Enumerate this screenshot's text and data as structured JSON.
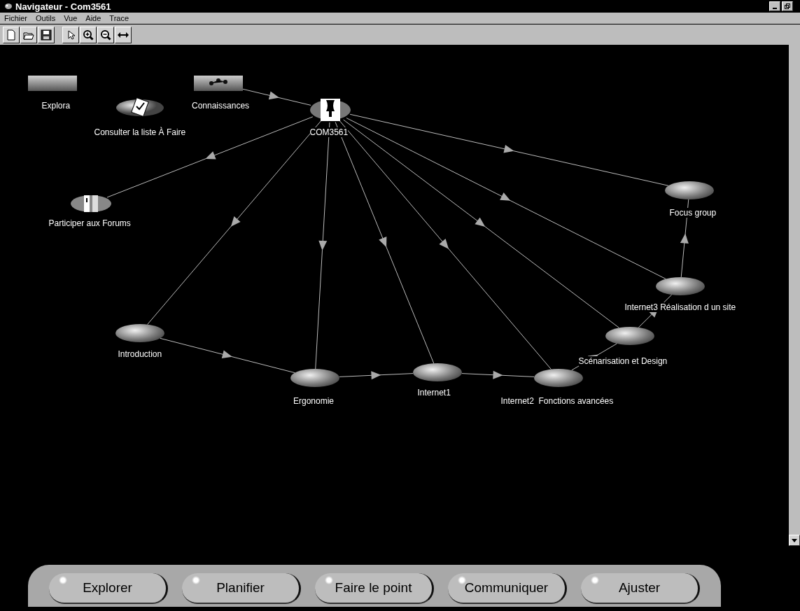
{
  "window": {
    "title": "Navigateur - Com3561"
  },
  "menu": [
    "Fichier",
    "Outils",
    "Vue",
    "Aide",
    "Trace"
  ],
  "toolbar": [
    {
      "kind": "new"
    },
    {
      "kind": "open"
    },
    {
      "kind": "save"
    },
    {
      "kind": "pointer"
    },
    {
      "kind": "zoom_in"
    },
    {
      "kind": "zoom_out"
    },
    {
      "kind": "fit"
    }
  ],
  "nodes": [
    {
      "label": "Explora",
      "kind": "box"
    },
    {
      "label": "Connaissances",
      "kind": "network"
    },
    {
      "label": "Consulter la liste À Faire",
      "kind": "checklist"
    },
    {
      "label": "COM3561",
      "kind": "hub"
    },
    {
      "label": "Participer aux Forums",
      "kind": "forum"
    },
    {
      "label": "Focus group",
      "kind": "ellipse"
    },
    {
      "label": "Internet3 Réalisation d un site",
      "kind": "ellipse"
    },
    {
      "label": "Introduction",
      "kind": "ellipse"
    },
    {
      "label": "Scénarisation et Design",
      "kind": "ellipse"
    },
    {
      "label": "Internet1",
      "kind": "ellipse"
    },
    {
      "label": "Ergonomie",
      "kind": "ellipse"
    },
    {
      "label": "Internet2  Fonctions avancées",
      "kind": "ellipse"
    }
  ],
  "buttons": [
    "Explorer",
    "Planifier",
    "Faire le point",
    "Communiquer",
    "Ajuster"
  ]
}
